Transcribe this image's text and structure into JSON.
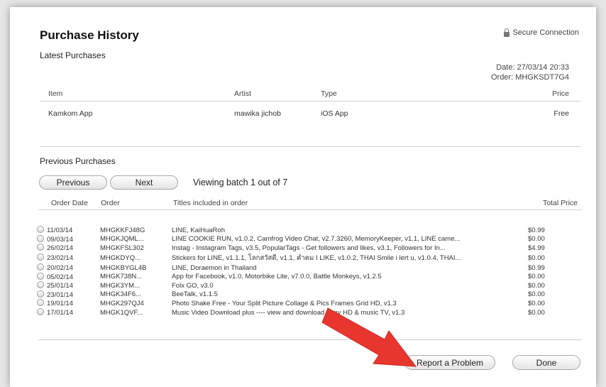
{
  "header": {
    "title": "Purchase History",
    "secure": "Secure Connection"
  },
  "latest": {
    "heading": "Latest Purchases",
    "date": "Date: 27/03/14 20:33",
    "order": "Order: MHGKSDT7G4",
    "columns": {
      "item": "Item",
      "artist": "Artist",
      "type": "Type",
      "price": "Price"
    },
    "row": {
      "item": "Kamkom App",
      "artist": "mawika jichob",
      "type": "iOS App",
      "price": "Free"
    }
  },
  "previous": {
    "heading": "Previous Purchases",
    "prev_label": "Previous",
    "next_label": "Next",
    "batch": "Viewing batch 1 out of 7",
    "columns": {
      "date": "Order Date",
      "order": "Order",
      "titles": "Titles included in order",
      "total": "Total Price"
    },
    "rows": [
      {
        "date": "11/03/14",
        "order": "MHGKKFJ48G",
        "titles": "LINE, KaiHuaRoh",
        "total": "$0.99"
      },
      {
        "date": "09/03/14",
        "order": "MHGKJQML...",
        "titles": "LINE COOKIE RUN, v1.0.2, Camfrog Video Chat, v2.7.3260, MemoryKeeper, v1.1, LINE came...",
        "total": "$0.00"
      },
      {
        "date": "26/02/14",
        "order": "MHGKFSL302",
        "titles": "Instag - Instagram Tags, v3.5, PopularTags - Get followers and likes, v3.1, Followers for In...",
        "total": "$4.99"
      },
      {
        "date": "23/02/14",
        "order": "MHGKDYQ...",
        "titles": "Stickers for LINE, v1.1.1, โลกสวัสดี, v1.1, คำคม I LIKE, v1.0.2, THAI Smile i lert u, v1.0.4, THAI...",
        "total": "$0.00"
      },
      {
        "date": "20/02/14",
        "order": "MHGKBYGL4B",
        "titles": "LINE, Doraemon in Thailand",
        "total": "$0.99"
      },
      {
        "date": "05/02/14",
        "order": "MHGK738N...",
        "titles": "App for Facebook, v1.0, Motorbike Lite, v7.0.0, Battle Monkeys, v1.2.5",
        "total": "$0.00"
      },
      {
        "date": "25/01/14",
        "order": "MHGK3YM...",
        "titles": "Folx GO, v3.0",
        "total": "$0.00"
      },
      {
        "date": "23/01/14",
        "order": "MHGK34F6...",
        "titles": "BeeTalk, v1.1.5",
        "total": "$0.00"
      },
      {
        "date": "19/01/14",
        "order": "MHGK297QJ4",
        "titles": "Photo Shake Free - Your Split Picture Collage & Pics Frames Grid HD, v1.3",
        "total": "$0.00"
      },
      {
        "date": "17/01/14",
        "order": "MHGK1QVF...",
        "titles": "Music Video Download plus ---- view and download pony HD & music TV, v1.3",
        "total": "$0.00"
      }
    ]
  },
  "footer": {
    "report_label": "Report a Problem",
    "done_label": "Done"
  },
  "colors": {
    "arrow": "#e8362f"
  }
}
